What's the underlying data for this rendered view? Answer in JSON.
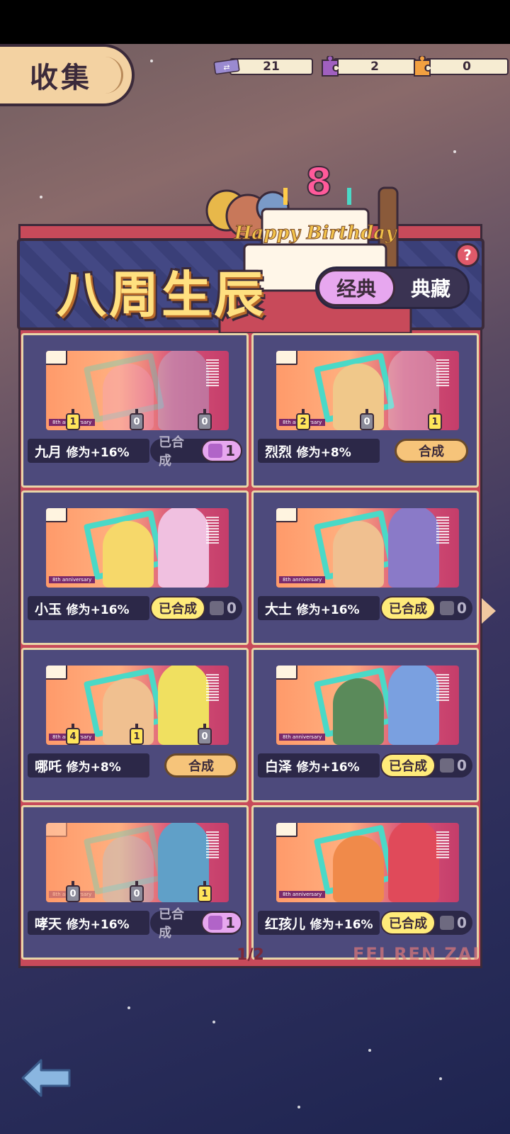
{
  "header": {
    "title": "收集"
  },
  "currencies": [
    {
      "icon": "ticket-icon",
      "value": "21"
    },
    {
      "icon": "purple-puzzle-icon",
      "value": "2"
    },
    {
      "icon": "orange-puzzle-icon",
      "value": "0"
    }
  ],
  "banner": {
    "title": "八周生辰",
    "cake_text": "Happy Birthday",
    "cake_number": "8",
    "mode_active": "经典",
    "mode_other": "典藏",
    "help": "?"
  },
  "cards": [
    {
      "name": "九月",
      "stat": "修为+16%",
      "pieces": [
        "1",
        "0",
        "0"
      ],
      "action": "已合成",
      "count": "1",
      "state": "pending-purple",
      "tag": "8th anniversary"
    },
    {
      "name": "烈烈",
      "stat": "修为+8%",
      "pieces": [
        "2",
        "0",
        "1"
      ],
      "action": "合成",
      "state": "make",
      "tag": "8th anniversary"
    },
    {
      "name": "小玉",
      "stat": "修为+16%",
      "pieces": [],
      "action": "已合成",
      "count": "0",
      "state": "done",
      "tag": "8th anniversary"
    },
    {
      "name": "大士",
      "stat": "修为+16%",
      "pieces": [],
      "action": "已合成",
      "count": "0",
      "state": "done",
      "tag": "8th anniversary"
    },
    {
      "name": "哪吒",
      "stat": "修为+8%",
      "pieces": [
        "4",
        "1",
        "0"
      ],
      "action": "合成",
      "state": "make",
      "tag": "8th anniversary"
    },
    {
      "name": "白泽",
      "stat": "修为+16%",
      "pieces": [],
      "action": "已合成",
      "count": "0",
      "state": "done",
      "tag": "8th anniversary"
    },
    {
      "name": "哮天",
      "stat": "修为+16%",
      "pieces": [
        "0",
        "0",
        "1"
      ],
      "action": "已合成",
      "count": "1",
      "state": "pending-purple",
      "tag": "8th anniversary"
    },
    {
      "name": "红孩儿",
      "stat": "修为+16%",
      "pieces": [],
      "action": "已合成",
      "count": "0",
      "state": "done",
      "tag": "8th anniversary"
    }
  ],
  "pager": {
    "text": "1/2"
  },
  "watermark": "FEI REN ZAI",
  "colors": {
    "panel_red": "#c84a5a",
    "card_bg": "#4d4a7c",
    "gold_text": "#ffe080",
    "accent_purple": "#e7a7ef",
    "badge_yellow": "#ffeb7a"
  }
}
